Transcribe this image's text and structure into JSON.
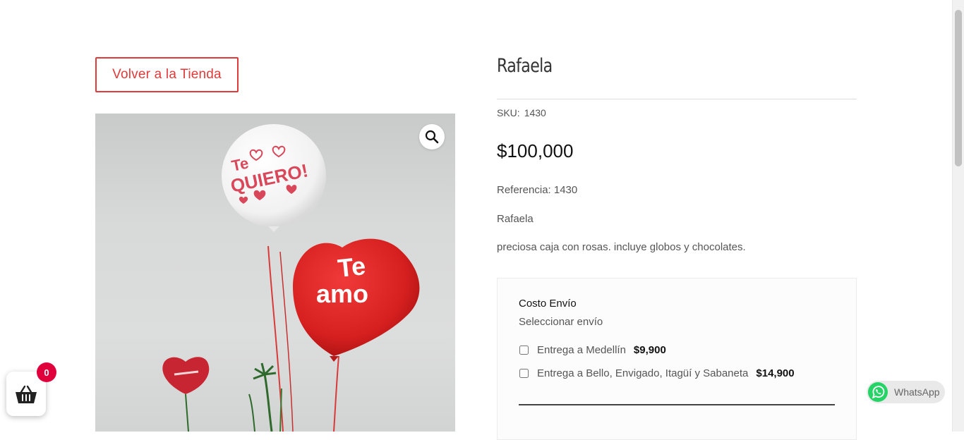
{
  "nav": {
    "back_label": "Volver a la Tienda"
  },
  "product": {
    "title": "Rafaela",
    "sku_label": "SKU:",
    "sku_value": "1430",
    "price": "$100,000",
    "description": [
      "Referencia: 1430",
      "Rafaela",
      "preciosa caja con rosas. incluye globos y chocolates."
    ],
    "image_text": {
      "balloon_white": [
        "Te",
        "QUIERO!"
      ],
      "balloon_red": [
        "Te",
        "amo"
      ]
    }
  },
  "shipping": {
    "title": "Costo Envío",
    "subtitle": "Seleccionar envío",
    "options": [
      {
        "label": "Entrega a Medellín",
        "price": "$9,900",
        "checked": false
      },
      {
        "label": "Entrega a Bello, Envigado, Itagüí y Sabaneta",
        "price": "$14,900",
        "checked": false
      }
    ]
  },
  "cart": {
    "count": "0",
    "icon": "basket-icon"
  },
  "whatsapp": {
    "label": "WhatsApp",
    "icon": "whatsapp-icon"
  },
  "icons": {
    "zoom": "search-icon"
  },
  "colors": {
    "accent": "#e03a3a",
    "badge": "#e0003c",
    "whatsapp": "#25d366"
  }
}
